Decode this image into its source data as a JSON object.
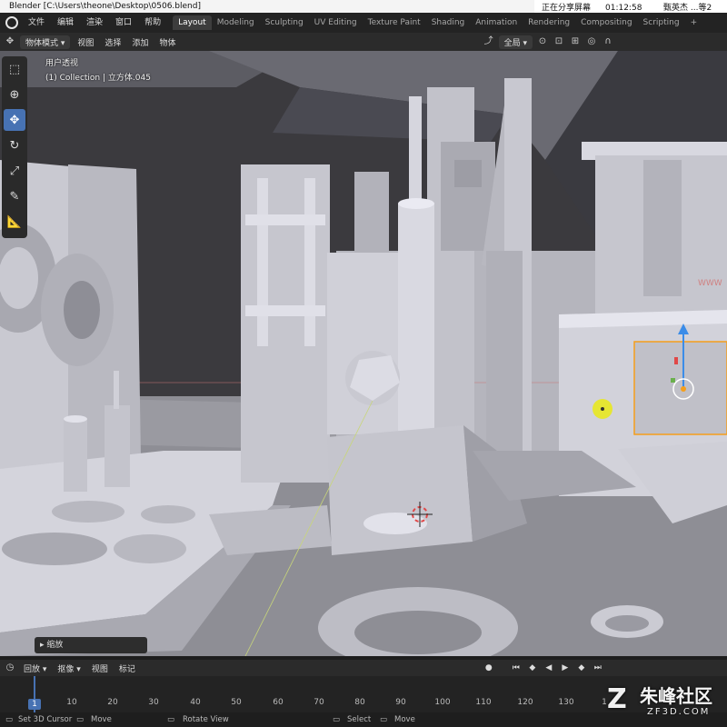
{
  "window": {
    "title": "Blender [C:\\Users\\theone\\Desktop\\0506.blend]"
  },
  "share_bar": {
    "status": "正在分享屏幕",
    "time": "01:12:58",
    "user": "甄英杰 ...等2"
  },
  "menu": {
    "items": [
      "文件",
      "编辑",
      "渲染",
      "窗口",
      "帮助"
    ]
  },
  "workspaces": [
    {
      "label": "Layout",
      "active": true
    },
    {
      "label": "Modeling",
      "active": false
    },
    {
      "label": "Sculpting",
      "active": false
    },
    {
      "label": "UV Editing",
      "active": false
    },
    {
      "label": "Texture Paint",
      "active": false
    },
    {
      "label": "Shading",
      "active": false
    },
    {
      "label": "Animation",
      "active": false
    },
    {
      "label": "Rendering",
      "active": false
    },
    {
      "label": "Compositing",
      "active": false
    },
    {
      "label": "Scripting",
      "active": false
    }
  ],
  "viewport_header": {
    "mode": "物体模式",
    "menus": [
      "视图",
      "选择",
      "添加",
      "物体"
    ],
    "orientation": "全局"
  },
  "viewport": {
    "view_name": "用户透视",
    "collection_info": "(1) Collection | 立方体.045"
  },
  "toolbar": {
    "tools": [
      {
        "icon": "select-box-icon",
        "active": false
      },
      {
        "icon": "cursor-icon",
        "active": false
      },
      {
        "icon": "move-icon",
        "active": true
      },
      {
        "icon": "rotate-icon",
        "active": false
      },
      {
        "icon": "scale-icon",
        "active": false
      },
      {
        "icon": "annotate-icon",
        "active": false
      },
      {
        "icon": "measure-icon",
        "active": false
      }
    ]
  },
  "last_operation": {
    "label": "缩放"
  },
  "timeline": {
    "menus": [
      "回放",
      "抠像",
      "视图",
      "标记"
    ],
    "current_frame": "1",
    "ticks": [
      "10",
      "20",
      "30",
      "40",
      "50",
      "60",
      "70",
      "80",
      "90",
      "100",
      "110",
      "120",
      "130",
      "1"
    ]
  },
  "statusbar": {
    "items": [
      "Set 3D Cursor",
      "Move",
      "Rotate View",
      "Select",
      "Move"
    ]
  },
  "watermark": {
    "main": "朱峰社区",
    "sub": "ZF3D.COM",
    "corner_text": "WWW"
  },
  "colors": {
    "accent": "#4772b3",
    "selection": "#f59e1b",
    "background": "#1d1d1d"
  }
}
